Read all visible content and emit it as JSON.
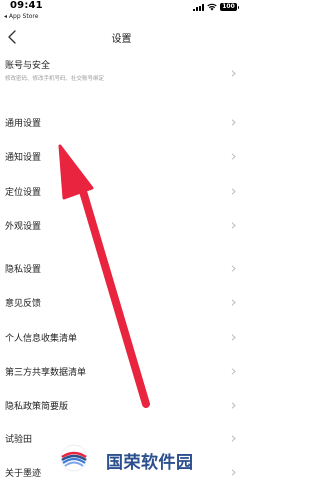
{
  "status_bar": {
    "time": "09:41",
    "back_app": "◂ App Store",
    "battery": "100"
  },
  "nav": {
    "title": "设置"
  },
  "items": [
    {
      "label": "账号与安全",
      "subtitle": "修改密码、修改手机号码、社交账号绑定"
    },
    {
      "label": "通用设置"
    },
    {
      "label": "通知设置"
    },
    {
      "label": "定位设置"
    },
    {
      "label": "外观设置"
    },
    {
      "label": "隐私设置"
    },
    {
      "label": "意见反馈"
    },
    {
      "label": "个人信息收集清单"
    },
    {
      "label": "第三方共享数据清单"
    },
    {
      "label": "隐私政策简要版"
    },
    {
      "label": "试验田"
    },
    {
      "label": "关于墨迹"
    }
  ],
  "watermark": {
    "text": "国荣软件园"
  },
  "colors": {
    "arrow": "#e8243f",
    "watermark_text": "#2c4f8e",
    "subtitle": "#9a9a9a"
  }
}
